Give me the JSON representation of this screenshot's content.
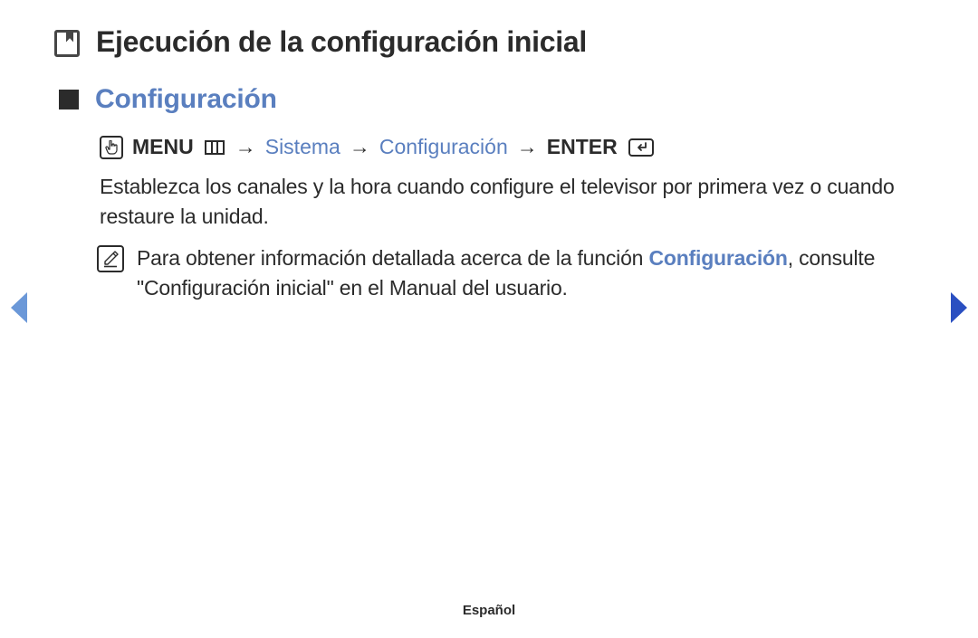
{
  "title": "Ejecución de la configuración inicial",
  "section_heading": "Configuración",
  "nav_path": {
    "menu_label": "MENU",
    "arrow": "→",
    "step1": "Sistema",
    "step2": "Configuración",
    "enter_label": "ENTER"
  },
  "body_paragraph": "Establezca los canales y la hora cuando configure el televisor por primera vez o cuando restaure la unidad.",
  "note": {
    "pre": "Para obtener información detallada acerca de la función ",
    "highlight": "Configuración",
    "post": ", consulte \"Configuración inicial\" en el Manual del usuario."
  },
  "footer_language": "Español"
}
